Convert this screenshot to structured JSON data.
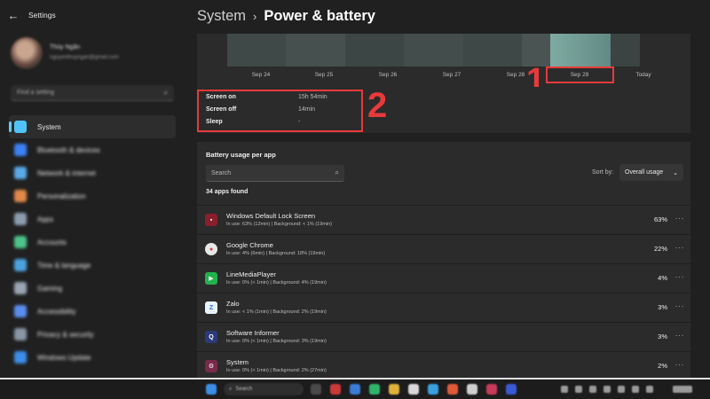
{
  "window": {
    "title": "Settings",
    "back": "←"
  },
  "profile": {
    "name": "Thùy Ngân",
    "email": "nguyenthuyngan@gmail.com"
  },
  "sidebar": {
    "search_placeholder": "Find a setting",
    "items": [
      {
        "label": "System",
        "icon": "monitor-icon",
        "color": "#4fc3f7",
        "active": true
      },
      {
        "label": "Bluetooth & devices",
        "icon": "bluetooth-icon",
        "color": "#3b82f6"
      },
      {
        "label": "Network & internet",
        "icon": "wifi-icon",
        "color": "#5aa9e6"
      },
      {
        "label": "Personalization",
        "icon": "brush-icon",
        "color": "#e0894a"
      },
      {
        "label": "Apps",
        "icon": "apps-icon",
        "color": "#8e9cb0"
      },
      {
        "label": "Accounts",
        "icon": "person-icon",
        "color": "#4cc38a"
      },
      {
        "label": "Time & language",
        "icon": "globe-clock-icon",
        "color": "#4aa3df"
      },
      {
        "label": "Gaming",
        "icon": "controller-icon",
        "color": "#9aa4b2"
      },
      {
        "label": "Accessibility",
        "icon": "accessibility-icon",
        "color": "#5b8def"
      },
      {
        "label": "Privacy & security",
        "icon": "shield-icon",
        "color": "#8a95a5"
      },
      {
        "label": "Windows Update",
        "icon": "update-icon",
        "color": "#3c8ee8"
      }
    ]
  },
  "header": {
    "parent": "System",
    "separator": "›",
    "current": "Power & battery"
  },
  "usage_chart": {
    "x_labels": [
      "Sep 24",
      "Sep 25",
      "Sep 26",
      "Sep 27",
      "Sep 28",
      "Sep 29",
      "Today"
    ],
    "selected": "Sep 29",
    "annotation_1": "1"
  },
  "screen_stats": {
    "annotation_2": "2",
    "rows": [
      {
        "label": "Screen on",
        "value": "15h 54min"
      },
      {
        "label": "Screen off",
        "value": "14min"
      },
      {
        "label": "Sleep",
        "value": "-"
      }
    ]
  },
  "battery_usage": {
    "title": "Battery usage per app",
    "search_placeholder": "Search",
    "sort_label": "Sort by:",
    "sort_value": "Overall usage",
    "count": "34 apps found",
    "apps": [
      {
        "name": "Windows Default Lock Screen",
        "detail": "In use: 63% (12min) | Background: < 1% (19min)",
        "percent": "63%",
        "icon": "lock-screen-icon",
        "color": "#8a1f2c"
      },
      {
        "name": "Google Chrome",
        "detail": "In use: 4% (6min) | Background: 18% (19min)",
        "percent": "22%",
        "icon": "chrome-icon",
        "color": "#e8e8e8"
      },
      {
        "name": "LineMediaPlayer",
        "detail": "In use: 0% (< 1min) | Background: 4% (19min)",
        "percent": "4%",
        "icon": "line-media-player-icon",
        "color": "#22b14c"
      },
      {
        "name": "Zalo",
        "detail": "In use: < 1% (1min) | Background: 2% (19min)",
        "percent": "3%",
        "icon": "zalo-icon",
        "color": "#e9f2ff"
      },
      {
        "name": "Software Informer",
        "detail": "In use: 0% (< 1min) | Background: 3% (19min)",
        "percent": "3%",
        "icon": "software-informer-icon",
        "color": "#2a3a7a"
      },
      {
        "name": "System",
        "detail": "In use: 0% (< 1min) | Background: 2% (27min)",
        "percent": "2%",
        "icon": "system-gear-icon",
        "color": "#7a2a4a"
      }
    ],
    "more": "···"
  },
  "taskbar": {
    "search_text": "Search"
  }
}
